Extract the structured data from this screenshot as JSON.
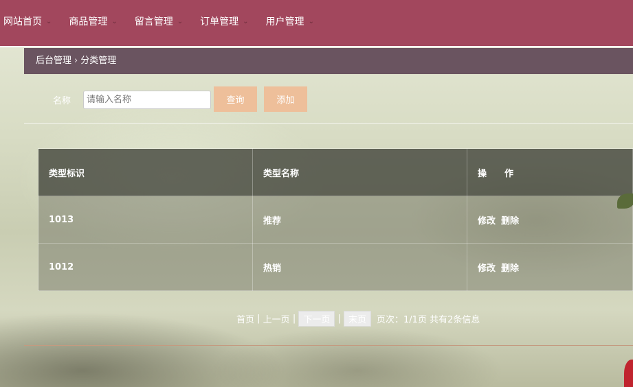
{
  "nav": {
    "items": [
      {
        "label": "网站首页"
      },
      {
        "label": "商品管理"
      },
      {
        "label": "留言管理"
      },
      {
        "label": "订单管理"
      },
      {
        "label": "用户管理"
      }
    ],
    "chevron": "⌄"
  },
  "breadcrumb": {
    "root": "后台管理",
    "separator": "›",
    "current": "分类管理"
  },
  "search": {
    "label": "名称",
    "placeholder": "请输入名称",
    "query_button": "查询",
    "add_button": "添加"
  },
  "table": {
    "headers": [
      "类型标识",
      "类型名称",
      "操　　作"
    ],
    "rows": [
      {
        "id": "1013",
        "name": "推荐",
        "edit": "修改",
        "delete": "删除"
      },
      {
        "id": "1012",
        "name": "热销",
        "edit": "修改",
        "delete": "删除"
      }
    ]
  },
  "pager": {
    "first": "首页",
    "sep1": " | ",
    "prev": "上一页",
    "sep2": " | ",
    "next": "下一页",
    "sep3": " | ",
    "last": "末页",
    "info": "页次：1/1页 共有2条信息"
  },
  "colors": {
    "nav_bg": "#a2475d",
    "crumb_bg": "#6a5460",
    "button_bg": "#eebf9a"
  }
}
